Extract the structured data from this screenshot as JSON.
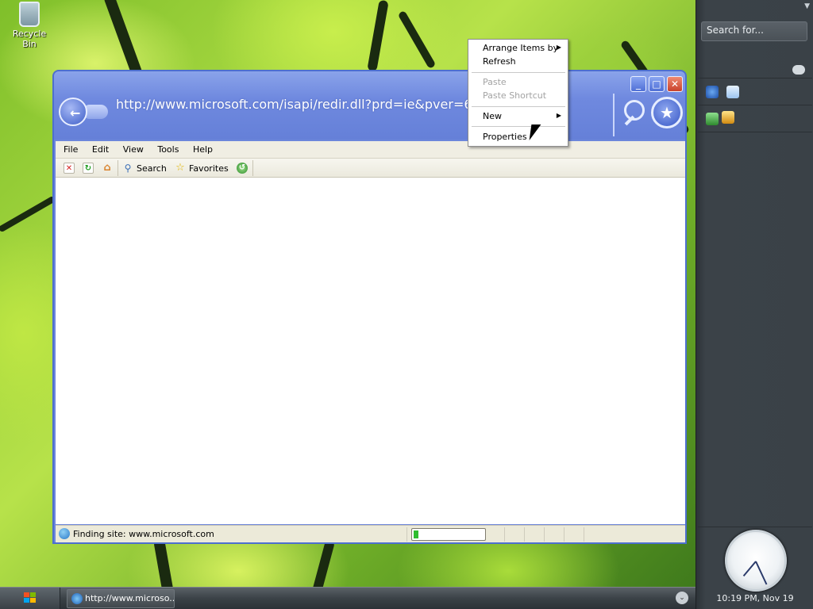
{
  "desktop": {
    "recycle_bin_label": "Recycle Bin"
  },
  "browser": {
    "address": "http://www.microsoft.com/isapi/redir.dll?prd=ie&pver=6&a",
    "menu": [
      "File",
      "Edit",
      "View",
      "Tools",
      "Help"
    ],
    "toolbar": {
      "search_label": "Search",
      "favorites_label": "Favorites"
    },
    "status_text": "Finding site: www.microsoft.com",
    "progress_fraction": 0.05
  },
  "context_menu": {
    "items": [
      {
        "label": "Arrange Items by",
        "disabled": false,
        "submenu": true
      },
      {
        "label": "Refresh",
        "disabled": false,
        "submenu": false
      },
      {
        "label": "Paste",
        "disabled": true,
        "submenu": false
      },
      {
        "label": "Paste Shortcut",
        "disabled": true,
        "submenu": false
      },
      {
        "label": "New",
        "disabled": false,
        "submenu": true
      },
      {
        "label": "Properties",
        "disabled": false,
        "submenu": false
      }
    ]
  },
  "sidebar": {
    "search_placeholder": "Search for...",
    "clock_label": "10:19 PM, Nov 19"
  },
  "taskbar": {
    "task_label": "http://www.microso..."
  },
  "colors": {
    "title_blue": "#6f89df",
    "progress_green": "#2fbd2f",
    "sidebar_bg": "#3a4147"
  }
}
